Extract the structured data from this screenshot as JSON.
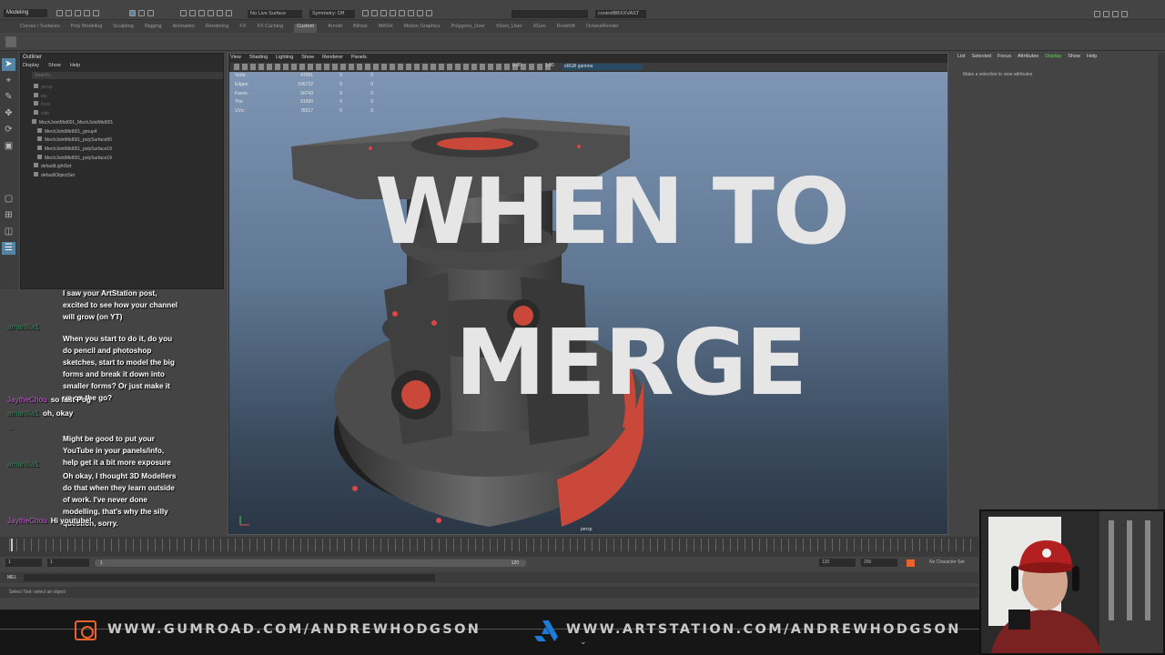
{
  "app": {
    "mode_menu": "Modeling",
    "live_surface": "No Live Surface",
    "symmetry": "Symmetry: Off",
    "search_field": "controlBBXXVAST"
  },
  "shelf_tabs": [
    "Curves / Surfaces",
    "Poly Modeling",
    "Sculpting",
    "Rigging",
    "Animation",
    "Rendering",
    "FX",
    "FX Caching",
    "Custom",
    "Arnold",
    "Bifrost",
    "MASH",
    "Motion Graphics",
    "Polygons_User",
    "XGen_User",
    "XGen",
    "Redshift",
    "OctaneRender"
  ],
  "shelf_active": "Custom",
  "outliner": {
    "title": "Outliner",
    "menu": [
      "Display",
      "Show",
      "Help"
    ],
    "search_placeholder": "Search...",
    "items": [
      "persp",
      "top",
      "front",
      "side",
      "MechJointMid001_MechJointMid001",
      "MechJointMid001_group4",
      "MechJointMid001_polySurface50",
      "MechJointMid001_polySurface19",
      "MechJointMid001_polySurface19",
      "defaultLightSet",
      "defaultObjectSet"
    ]
  },
  "chat": [
    {
      "user": "",
      "text": "I saw your ArtStation post, excited to see how your channel will grow (on YT)",
      "user_color": "#d35fd3"
    },
    {
      "user": "amarillia1",
      "text": "When you start to do it, do you do pencil and photoshop sketches, start to model the big forms and break it down into smaller forms? Or just make it up on the go?",
      "user_color": "#2e8b57"
    },
    {
      "user": "JaytheChou",
      "text": "so fast Pog",
      "user_color": "#c65bd6"
    },
    {
      "user": "amarillia1",
      "text": "oh, okay",
      "user_color": "#2e8b57"
    },
    {
      "user": "...",
      "text": "Might be good to put your YouTube in your panels/info, help get it a bit more exposure",
      "user_color": "#c0392b"
    },
    {
      "user": "amarillia1",
      "text": "Oh okay, I thought 3D Modellers do that when they learn outside of work. I've never done modelling, that's why the silly question, sorry.",
      "user_color": "#2e8b57"
    },
    {
      "user": "JaytheChou",
      "text": "Hi youtube!",
      "user_color": "#c65bd6"
    }
  ],
  "viewport": {
    "menu": [
      "View",
      "Shading",
      "Lighting",
      "Show",
      "Renderer",
      "Panels"
    ],
    "colorspace": "sRGB gamma",
    "exposure": "0.00",
    "gamma": "1.00",
    "hud": [
      {
        "label": "Verts:",
        "a": "47091",
        "b": "0",
        "c": "0"
      },
      {
        "label": "Edges:",
        "a": "106722",
        "b": "0",
        "c": "0"
      },
      {
        "label": "Faces:",
        "a": "56743",
        "b": "0",
        "c": "0"
      },
      {
        "label": "Tris:",
        "a": "91690",
        "b": "0",
        "c": "0"
      },
      {
        "label": "UVs:",
        "a": "78217",
        "b": "0",
        "c": "0"
      }
    ],
    "camera": "persp",
    "overlay_line1": "WHEN TO",
    "overlay_line2": "MERGE"
  },
  "attribute_editor": {
    "menu": [
      "List",
      "Selected",
      "Focus",
      "Attributes",
      "Display",
      "Show",
      "Help"
    ],
    "highlight": "Display",
    "message": "Make a selection to view attributes"
  },
  "range": {
    "start": "1",
    "current": "1",
    "slider_start": "1",
    "slider_end": "120",
    "end": "120",
    "anim_end": "200",
    "character": "No Character Set"
  },
  "mel_label": "MEL",
  "help_line": "Select Tool: select an object",
  "banner": {
    "gumroad": "WWW.GUMROAD.COM/ANDREWHODGSON",
    "artstation": "WWW.ARTSTATION.COM/ANDREWHODGSON"
  },
  "colors": {
    "accent": "#5285a6",
    "gumroad": "#e8642c",
    "artstation": "#1e7bd8",
    "model_body": "#4a4a4a",
    "model_red": "#c9483a"
  }
}
